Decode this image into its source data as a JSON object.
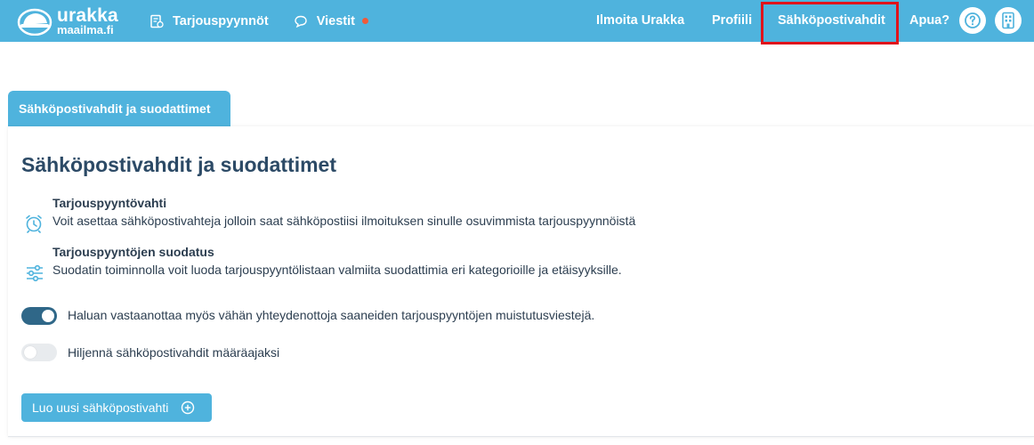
{
  "nav": {
    "logo_line1": "urakka",
    "logo_line2": "maailma.fi",
    "requests": "Tarjouspyynnöt",
    "messages": "Viestit",
    "post_job": "Ilmoita Urakka",
    "profile": "Profiili",
    "email_alerts": "Sähköpostivahdit",
    "help": "Apua?",
    "notification_color": "#ef5a3a"
  },
  "tab": {
    "label": "Sähköpostivahdit ja suodattimet"
  },
  "main": {
    "title": "Sähköpostivahdit ja suodattimet",
    "features": [
      {
        "title": "Tarjouspyyntövahti",
        "description": "Voit asettaa sähköpostivahteja jolloin saat sähköpostiisi ilmoituksen sinulle osuvimmista tarjouspyynnöistä",
        "icon": "alarm-clock-icon"
      },
      {
        "title": "Tarjouspyyntöjen suodatus",
        "description": "Suodatin toiminnolla voit luoda tarjouspyyntölistaan valmiita suodattimia eri kategorioille ja etäisyyksille.",
        "icon": "sliders-icon"
      }
    ],
    "toggles": [
      {
        "label": "Haluan vastaanottaa myös vähän yhteydenottoja saaneiden tarjouspyyntöjen muistutusviestejä.",
        "on": true
      },
      {
        "label": "Hiljennä sähköpostivahdit määräajaksi",
        "on": false
      }
    ],
    "create_button": "Luo uusi sähköpostivahti"
  },
  "colors": {
    "brand": "#4fb3dd",
    "toggle_on": "#2f6788",
    "highlight": "#e0131b"
  }
}
